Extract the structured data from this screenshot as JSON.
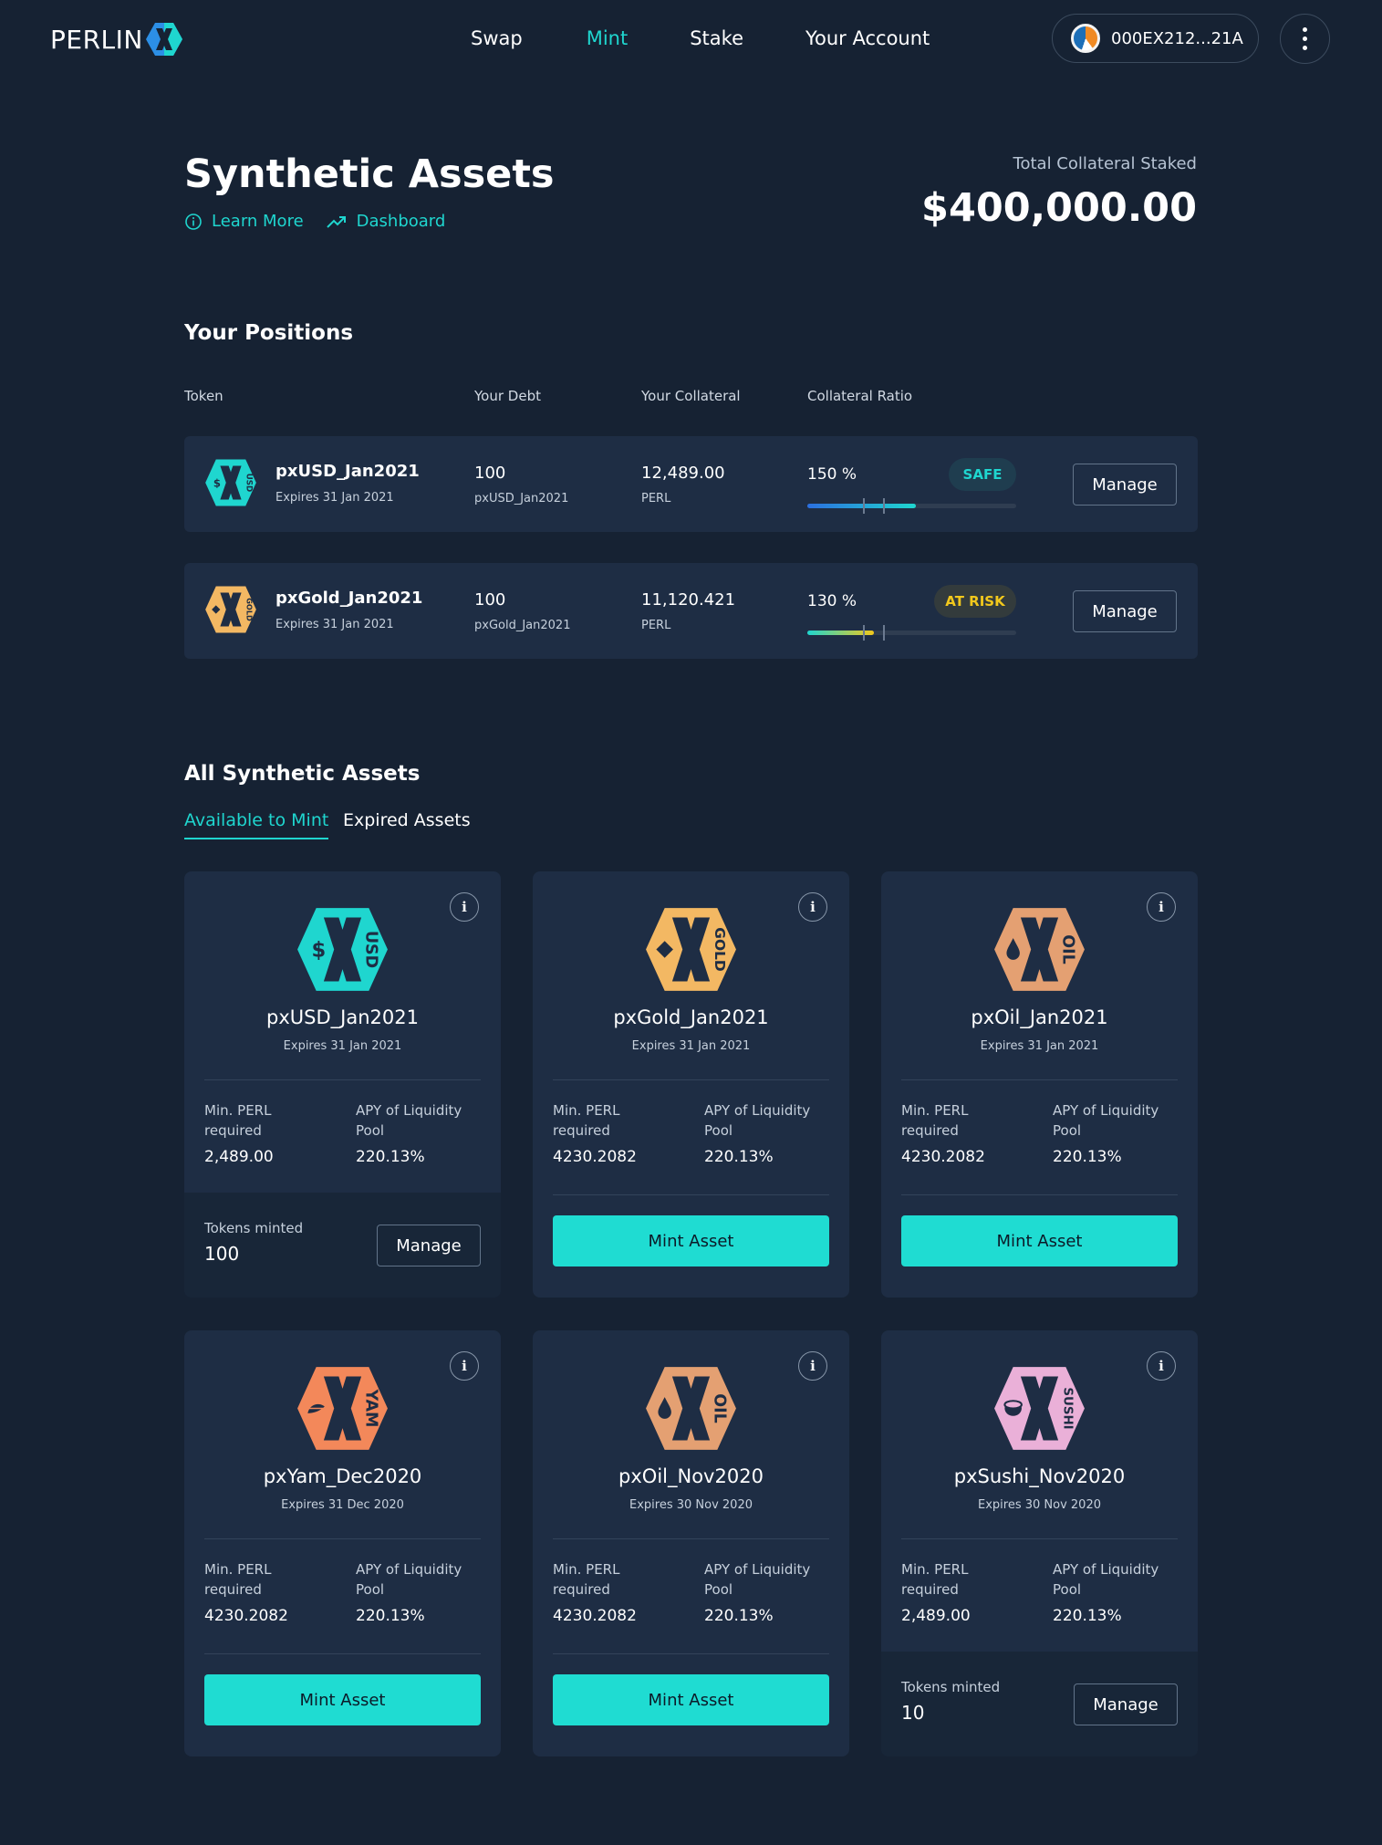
{
  "header": {
    "logo_text": "PERLIN",
    "nav": [
      "Swap",
      "Mint",
      "Stake",
      "Your Account"
    ],
    "active_nav": "Mint",
    "wallet_address": "000EX212...21A"
  },
  "page": {
    "title": "Synthetic Assets",
    "learn_more": "Learn More",
    "dashboard": "Dashboard",
    "total_label": "Total Collateral Staked",
    "total_value": "$400,000.00"
  },
  "positions": {
    "title": "Your Positions",
    "headers": {
      "token": "Token",
      "debt": "Your Debt",
      "collateral": "Your Collateral",
      "ratio": "Collateral Ratio"
    },
    "rows": [
      {
        "name": "pxUSD_Jan2021",
        "expires": "Expires 31 Jan 2021",
        "debt": "100",
        "debt_unit": "pxUSD_Jan2021",
        "collateral": "12,489.00",
        "collateral_unit": "PERL",
        "ratio": "150 %",
        "ratio_level": 0.52,
        "status": "SAFE",
        "manage": "Manage",
        "icon": "usd"
      },
      {
        "name": "pxGold_Jan2021",
        "expires": "Expires 31 Jan 2021",
        "debt": "100",
        "debt_unit": "pxGold_Jan2021",
        "collateral": "11,120.421",
        "collateral_unit": "PERL",
        "ratio": "130 %",
        "ratio_level": 0.32,
        "status": "AT RISK",
        "manage": "Manage",
        "icon": "gold"
      }
    ]
  },
  "assets": {
    "title": "All Synthetic Assets",
    "tabs": [
      "Available to Mint",
      "Expired Assets"
    ],
    "active_tab": "Available to Mint",
    "min_label": "Min. PERL required",
    "apy_label": "APY of Liquidity Pool",
    "mint_label": "Mint Asset",
    "minted_label": "Tokens minted",
    "manage_label": "Manage",
    "cards": [
      {
        "name": "pxUSD_Jan2021",
        "expires": "Expires 31 Jan 2021",
        "min": "2,489.00",
        "apy": "220.13%",
        "minted": "100",
        "icon": "usd",
        "color": "#1fd6cf",
        "tag": "USD"
      },
      {
        "name": "pxGold_Jan2021",
        "expires": "Expires 31 Jan 2021",
        "min": "4230.2082",
        "apy": "220.13%",
        "minted": null,
        "icon": "gold",
        "color": "#f3b863",
        "tag": "GOLD"
      },
      {
        "name": "pxOil_Jan2021",
        "expires": "Expires 31 Jan 2021",
        "min": "4230.2082",
        "apy": "220.13%",
        "minted": null,
        "icon": "oil",
        "color": "#e4a072",
        "tag": "OIL"
      },
      {
        "name": "pxYam_Dec2020",
        "expires": "Expires 31 Dec 2020",
        "min": "4230.2082",
        "apy": "220.13%",
        "minted": null,
        "icon": "yam",
        "color": "#f3885a",
        "tag": "YAM"
      },
      {
        "name": "pxOil_Nov2020",
        "expires": "Expires 30 Nov 2020",
        "min": "4230.2082",
        "apy": "220.13%",
        "minted": null,
        "icon": "oil",
        "color": "#e4a072",
        "tag": "OIL"
      },
      {
        "name": "pxSushi_Nov2020",
        "expires": "Expires 30 Nov 2020",
        "min": "2,489.00",
        "apy": "220.13%",
        "minted": "10",
        "icon": "sushi",
        "color": "#eab0d8",
        "tag": "SUSHI"
      }
    ]
  },
  "colors": {
    "accent": "#1fd6cf",
    "background": "#162233",
    "card": "#1e2d44",
    "safe": "#1fd6cf",
    "at_risk": "#f2c81c"
  }
}
